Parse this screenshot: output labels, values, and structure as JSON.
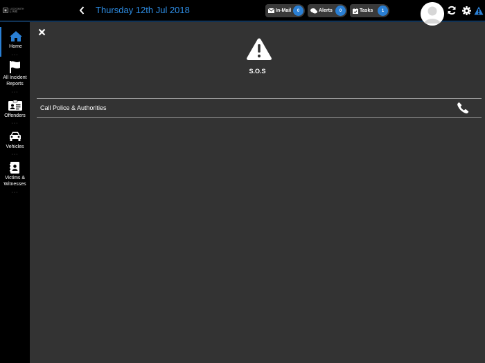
{
  "app": {
    "logo_text": "LIVE",
    "logo_subtext": "LOCKSMITH"
  },
  "header": {
    "date": "Thursday 12th Jul 2018",
    "inmail": {
      "label": "In-Mail",
      "count": "0"
    },
    "alerts": {
      "label": "Alerts",
      "count": "0"
    },
    "tasks": {
      "label": "Tasks",
      "count": "1"
    }
  },
  "sidebar": {
    "items": [
      {
        "label": "Home",
        "icon": "home-icon"
      },
      {
        "label": "All Incident Reports",
        "icon": "flag-icon"
      },
      {
        "label": "Offenders",
        "icon": "id-card-icon"
      },
      {
        "label": "Vehicles",
        "icon": "car-icon"
      },
      {
        "label": "Victims & Witnesses",
        "icon": "address-book-icon"
      }
    ]
  },
  "sos": {
    "title": "S.O.S",
    "action_label": "Call Police & Authorities"
  },
  "colors": {
    "accent": "#2a7fd4",
    "date": "#2e8ee6",
    "panel": "#333333",
    "warning": "#2a7fd4"
  }
}
